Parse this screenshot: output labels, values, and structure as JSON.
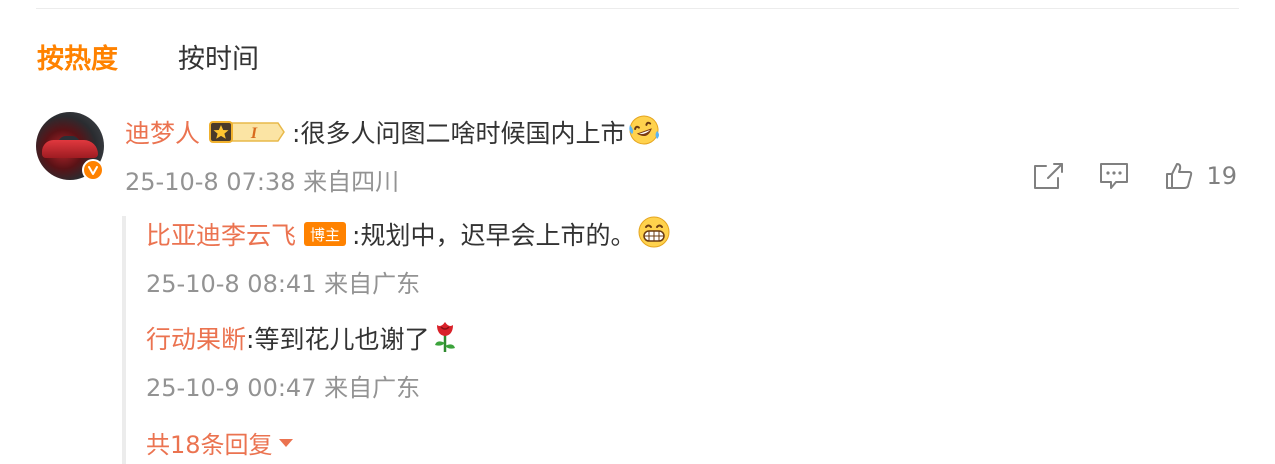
{
  "tabs": {
    "hot": "按热度",
    "time": "按时间"
  },
  "comment": {
    "username": "迪梦人",
    "text": ":很多人问图二啥时候国内上市",
    "emoji": "laughing-tears-emoji",
    "meta": "25-10-8 07:38 来自四川",
    "like_count": "19"
  },
  "replies": [
    {
      "username": "比亚迪李云飞",
      "tag": "博主",
      "text": ":规划中，迟早会上市的。",
      "emoji": "grin-emoji",
      "meta": "25-10-8 08:41 来自广东"
    },
    {
      "username": "行动果断",
      "text": ":等到花儿也谢了",
      "emoji": "rose-emoji",
      "meta": "25-10-9 00:47 来自广东"
    }
  ],
  "more_replies": "共18条回复",
  "colors": {
    "accent": "#ff8200",
    "username": "#eb7350",
    "meta": "#939393"
  }
}
